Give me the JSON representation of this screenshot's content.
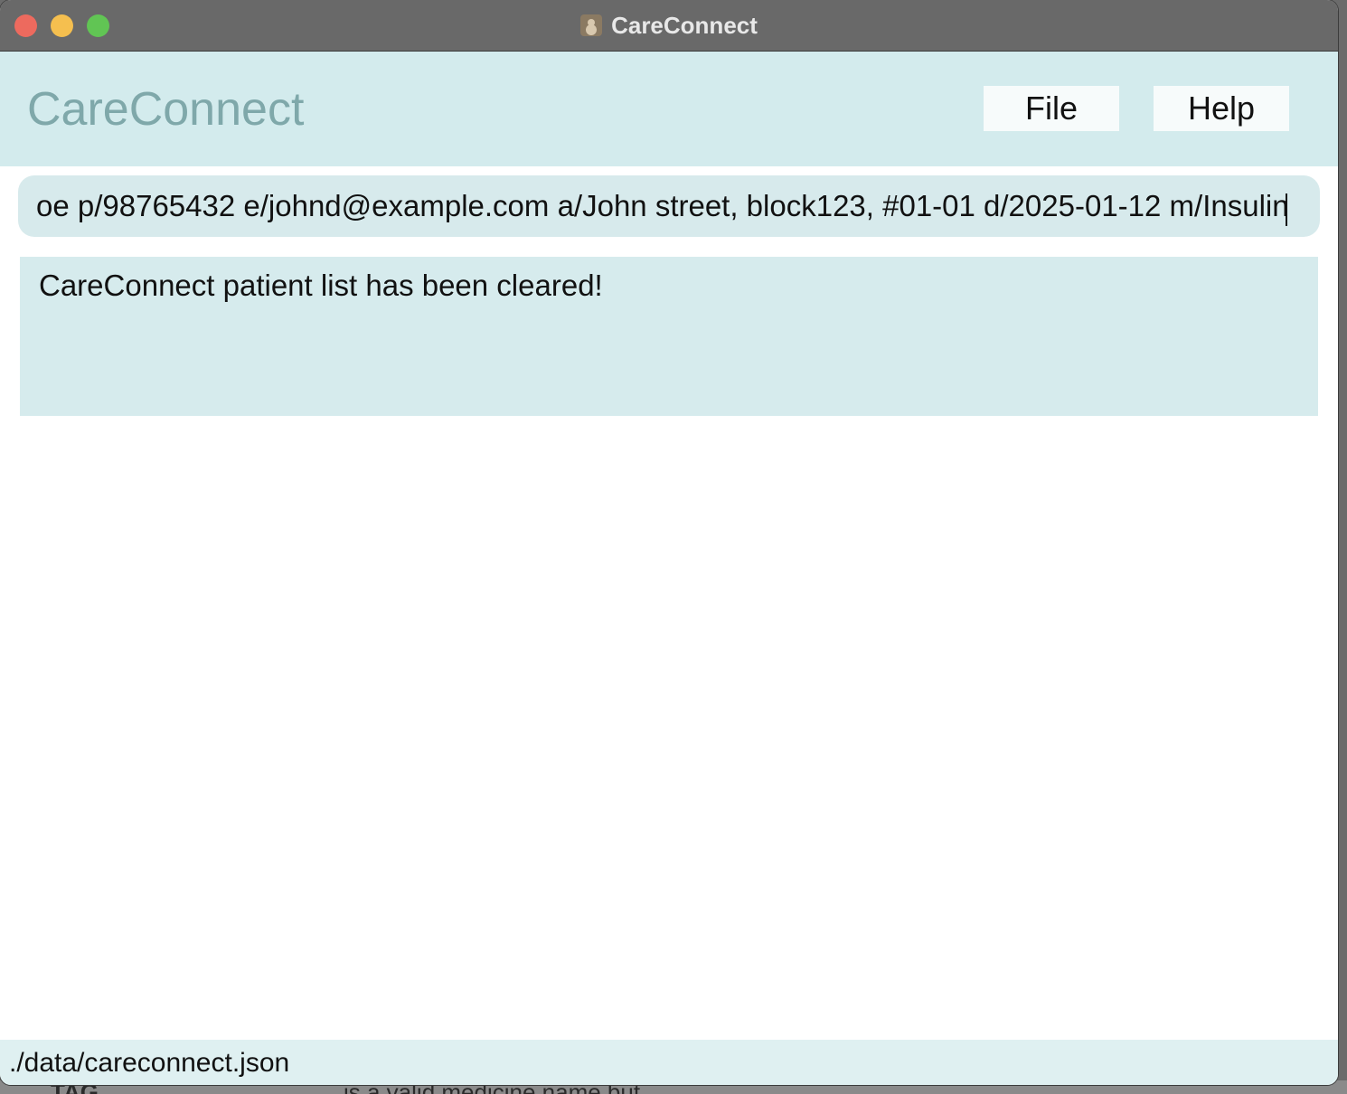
{
  "window": {
    "title": "CareConnect"
  },
  "header": {
    "brand": "CareConnect",
    "menu": {
      "file_label": "File",
      "help_label": "Help"
    }
  },
  "command": {
    "value": "oe p/98765432 e/johnd@example.com a/John street, block123, #01-01 d/2025-01-12 m/Insulin"
  },
  "result": {
    "message": "CareConnect patient list has been cleared!"
  },
  "status": {
    "file_path": "./data/careconnect.json"
  },
  "background_window": {
    "tag_text": "TAG",
    "desc_text": "is a valid medicine name but"
  },
  "colors": {
    "header_bg": "#d3ebed",
    "brand_text": "#7fa8aa",
    "command_bg": "#d7eaec",
    "result_bg": "#d6ebed",
    "status_bg": "#dff0f1"
  }
}
